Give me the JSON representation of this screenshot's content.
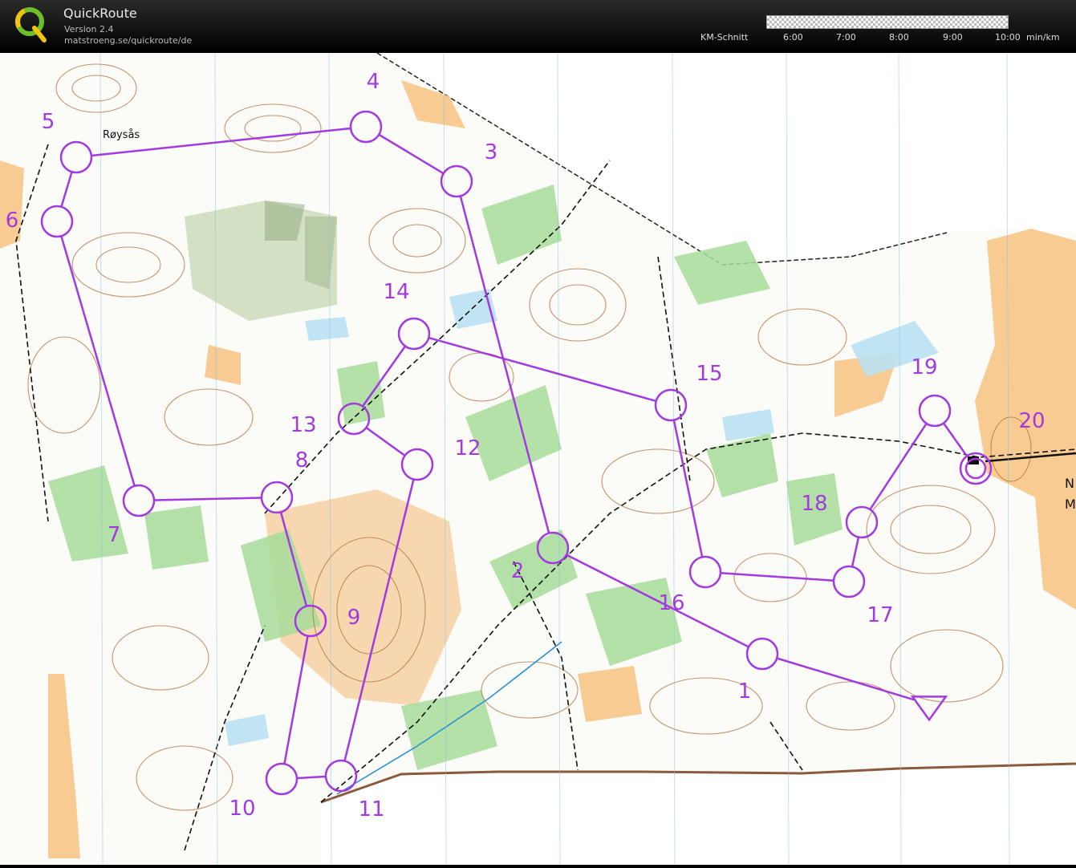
{
  "header": {
    "app_name": "QuickRoute",
    "version": "Version 2.4",
    "url": "matstroeng.se/quickroute/de",
    "pace_title": "KM-Schnitt",
    "pace_ticks": [
      "6:00",
      "7:00",
      "8:00",
      "9:00",
      "10:00"
    ],
    "pace_unit": "min/km"
  },
  "map": {
    "place_name": "Røysås",
    "edge_text": [
      "N",
      "M"
    ],
    "course_color": "#a23adf",
    "course_sequence": [
      "1",
      "2",
      "3",
      "4",
      "5",
      "6",
      "7",
      "8",
      "9",
      "10",
      "11",
      "12",
      "13",
      "14",
      "15",
      "16",
      "17",
      "18",
      "19",
      "20"
    ],
    "controls": [
      {
        "label": "1"
      },
      {
        "label": "2"
      },
      {
        "label": "3"
      },
      {
        "label": "4"
      },
      {
        "label": "5"
      },
      {
        "label": "6"
      },
      {
        "label": "7"
      },
      {
        "label": "8"
      },
      {
        "label": "9"
      },
      {
        "label": "10"
      },
      {
        "label": "11"
      },
      {
        "label": "12"
      },
      {
        "label": "13"
      },
      {
        "label": "14"
      },
      {
        "label": "15"
      },
      {
        "label": "16"
      },
      {
        "label": "17"
      },
      {
        "label": "18"
      },
      {
        "label": "19"
      },
      {
        "label": "20"
      }
    ]
  }
}
